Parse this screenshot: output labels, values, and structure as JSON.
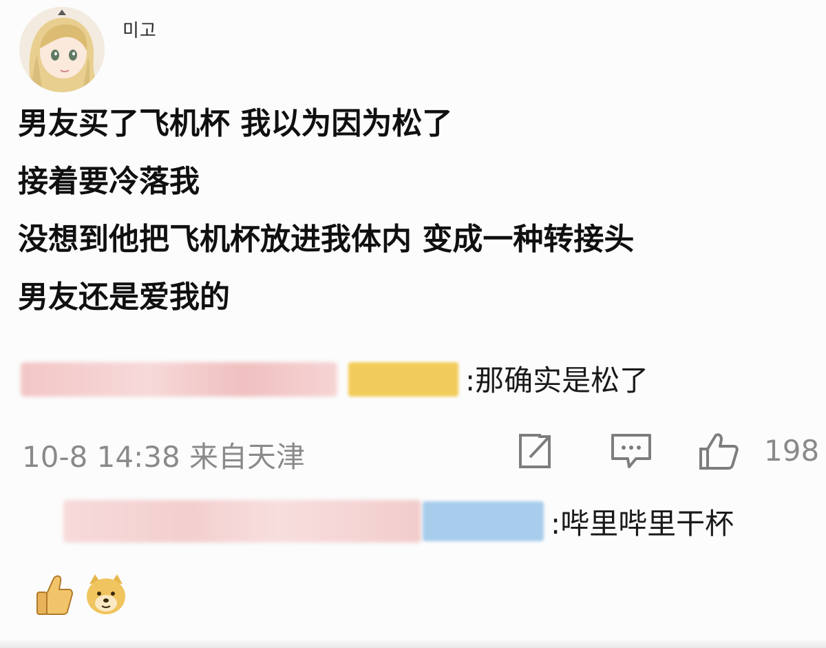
{
  "post": {
    "username": "미고",
    "lines": [
      "男友买了飞机杯 我以为因为松了",
      "接着要冷落我",
      "没想到他把飞机杯放进我体内 变成一种转接头",
      "男友还是爱我的"
    ]
  },
  "comments": [
    {
      "text": ":那确实是松了",
      "name_blur_color": "#f1c8c8",
      "badge_color": "#f2cc5a"
    },
    {
      "text": ":哔里哔里干杯",
      "name_blur_color": "#f5d3d3",
      "badge_color": "#a8cdec"
    }
  ],
  "meta": {
    "time_location": "10-8 14:38 来自天津",
    "like_count": "198"
  },
  "icons": {
    "share": "share-icon",
    "comment": "comment-icon",
    "like": "like-icon",
    "emoji_1": "thumbs-up-emoji",
    "emoji_2": "doge-emoji"
  }
}
